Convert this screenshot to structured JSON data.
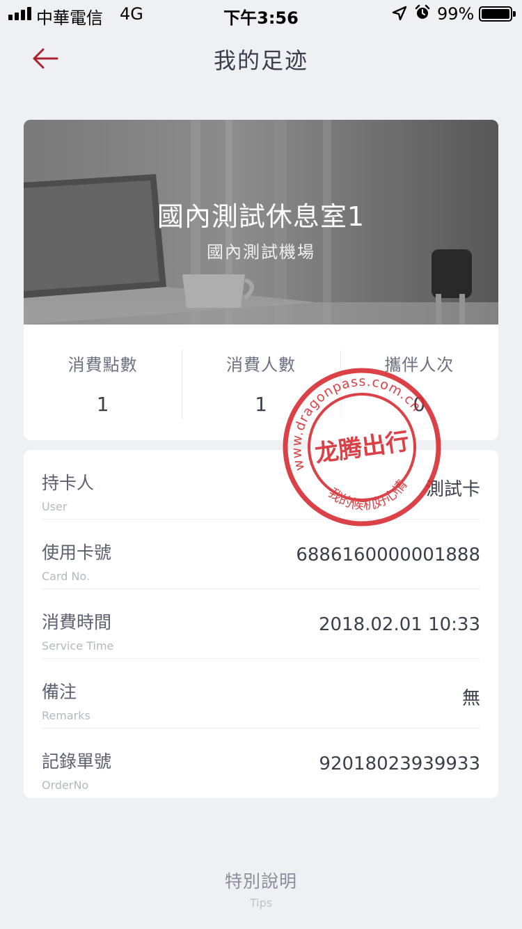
{
  "status_bar": {
    "carrier": "中華電信",
    "network": "4G",
    "time": "下午3:56",
    "battery_percent": "99%",
    "battery_level": 0.99,
    "signal_bars": 4
  },
  "nav": {
    "back_icon": "back-arrow-icon",
    "title": "我的足迹",
    "accent_color": "#a8232f"
  },
  "lounge": {
    "name": "國內測試休息室1",
    "airport": "國內測試機場",
    "stats": [
      {
        "label": "消費點數",
        "value": "1"
      },
      {
        "label": "消費人數",
        "value": "1"
      },
      {
        "label": "攜伴人次",
        "value": "0"
      }
    ]
  },
  "details": [
    {
      "label": "持卡人",
      "sublabel": "User",
      "value": "測試卡"
    },
    {
      "label": "使用卡號",
      "sublabel": "Card No.",
      "value": "6886160000001888"
    },
    {
      "label": "消費時間",
      "sublabel": "Service Time",
      "value": "2018.02.01 10:33"
    },
    {
      "label": "備注",
      "sublabel": "Remarks",
      "value": "無"
    },
    {
      "label": "記錄單號",
      "sublabel": "OrderNo",
      "value": "92018023939933"
    }
  ],
  "tips": {
    "title": "特別說明",
    "subtitle": "Tips"
  },
  "stamp": {
    "url_text": "www.dragonpass.com.cn",
    "brand_text": "龙腾出行",
    "slogan_text": "我的候机好心情",
    "color": "#d6282f"
  }
}
